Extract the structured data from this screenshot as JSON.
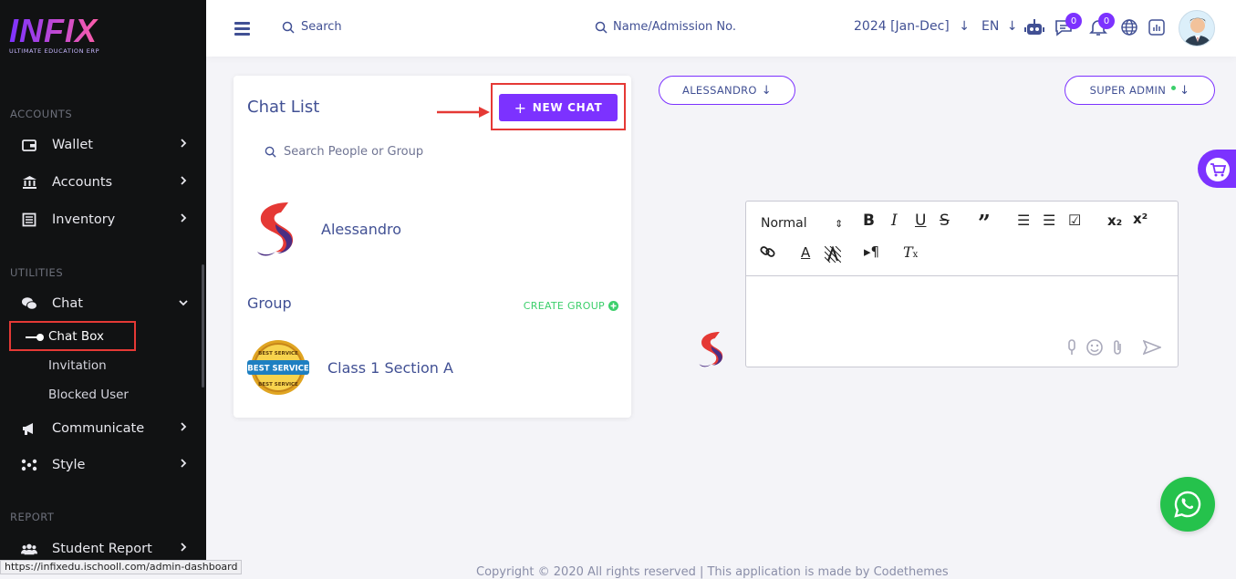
{
  "colors": {
    "accent": "#7c32ff",
    "sidebar_bg": "#111213",
    "text": "#415094",
    "highlight_border": "#e53935",
    "success": "#3ccf6b",
    "whatsapp": "#25c24c"
  },
  "brand": {
    "name": "INFIX",
    "tagline": "ULTIMATE EDUCATION ERP"
  },
  "sidebar": {
    "sections": [
      {
        "title": "ACCOUNTS"
      },
      {
        "title": "UTILITIES"
      },
      {
        "title": "REPORT"
      }
    ],
    "items": [
      {
        "label": "Wallet",
        "icon": "wallet-icon"
      },
      {
        "label": "Accounts",
        "icon": "bank-icon"
      },
      {
        "label": "Inventory",
        "icon": "inventory-icon"
      },
      {
        "label": "Chat",
        "icon": "chat-icon"
      },
      {
        "label": "Communicate",
        "icon": "megaphone-icon"
      },
      {
        "label": "Style",
        "icon": "style-icon"
      },
      {
        "label": "Student Report",
        "icon": "users-icon"
      }
    ],
    "chat_sub": [
      "Chat Box",
      "Invitation",
      "Blocked User"
    ]
  },
  "status_url": "https://infixedu.ischooll.com/admin-dashboard",
  "topbar": {
    "search_label": "Search",
    "admission_search": "Name/Admission No.",
    "year": "2024 [Jan-Dec]",
    "lang": "EN",
    "messages_count": "0",
    "notifications_count": "0"
  },
  "chat_list": {
    "title": "Chat List",
    "new_chat": "NEW CHAT",
    "search_placeholder": "Search People or Group",
    "contacts": [
      {
        "name": "Alessandro"
      }
    ],
    "group_title": "Group",
    "create_group": "CREATE GROUP",
    "groups": [
      {
        "name": "Class 1 Section A",
        "badge_top": "BEST SERVICE",
        "badge_mid": "BEST SERVICE",
        "badge_bot": "BEST SERVICE"
      }
    ]
  },
  "conversation": {
    "contact_button": "ALESSANDRO",
    "role_button": "SUPER ADMIN",
    "editor_format": "Normal"
  },
  "footer": "Copyright © 2020 All rights reserved | This application is made by Codethemes"
}
